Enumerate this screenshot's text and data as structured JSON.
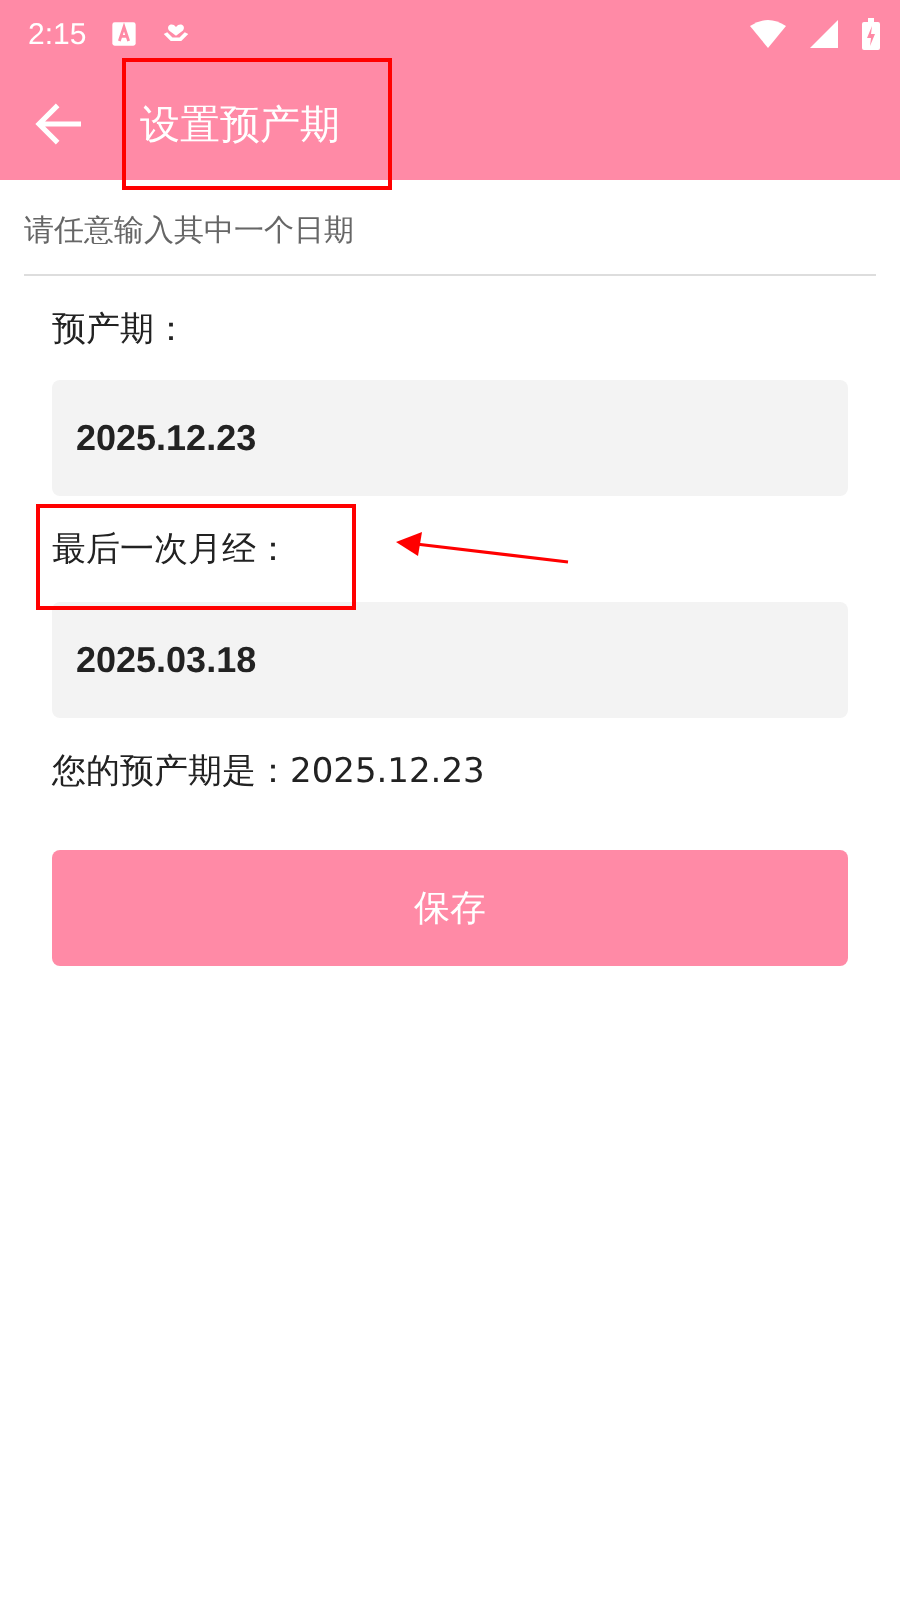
{
  "status_bar": {
    "time": "2:15"
  },
  "app_bar": {
    "title": "设置预产期",
    "title_highlighted": true
  },
  "hint": "请任意输入其中一个日期",
  "fields": [
    {
      "label": "预产期：",
      "value": "2025.12.23",
      "highlighted": false,
      "pointed": false
    },
    {
      "label": "最后一次月经：",
      "value": "2025.03.18",
      "highlighted": true,
      "pointed": true
    }
  ],
  "result": "您的预产期是：2025.12.23",
  "button": "保存"
}
